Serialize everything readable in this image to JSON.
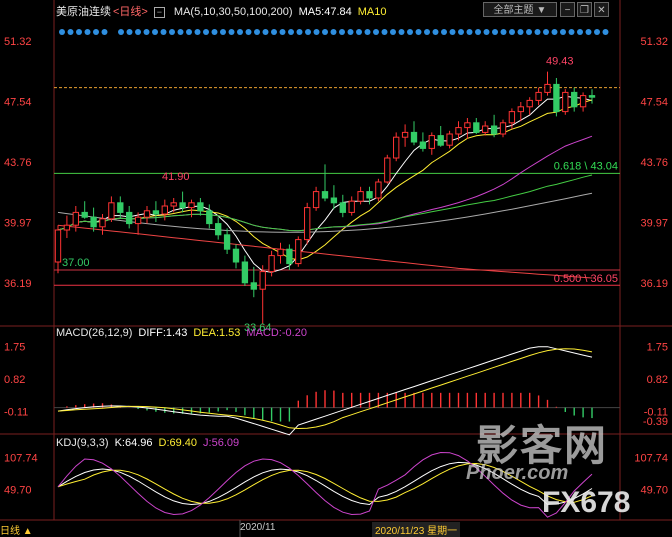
{
  "header": {
    "instrument": "美原油连续",
    "period": "<日线>",
    "ma_label": "MA(5,10,30,50,100,200)",
    "ma5_label": "MA5:47.84",
    "ma10_label": "MA10",
    "theme_button": "全部主题",
    "theme_arrow": "▼"
  },
  "macd_header": {
    "title": "MACD(26,12,9)",
    "diff": "DIFF:1.43",
    "dea": "DEA:1.53",
    "macd": "MACD:-0.20"
  },
  "kdj_header": {
    "title": "KDJ(9,3,3)",
    "k": "K:64.96",
    "d": "D:69.40",
    "j": "J:56.09"
  },
  "price_axis_ticks": [
    "51.32",
    "47.54",
    "43.76",
    "39.97",
    "36.19"
  ],
  "macd_axis_ticks": [
    "1.75",
    "0.82",
    "-0.11"
  ],
  "macd_axis_extra": "-0.39",
  "kdj_axis_ticks": [
    "107.74",
    "49.70"
  ],
  "annotations": {
    "high": "49.43",
    "low": "33.64",
    "peak_left": "41.90",
    "level_37": "37.00",
    "fib_618": "0.618 \\ 43.04",
    "fib_500": "0.500 \\ 36.05"
  },
  "footer": {
    "period_tab": "日线 ▲",
    "month_label": "2020/11",
    "cursor_date": "2020/11/23 星期一"
  },
  "watermark": {
    "cn": "影客网",
    "en": "Phoer.com",
    "brand": "FX678"
  },
  "colors": {
    "up": "#ff3333",
    "down": "#33cc66",
    "ma5": "#ffffff",
    "ma10": "#ffee33",
    "ma30": "#cc44cc",
    "ma50": "#44cc44",
    "ma100": "#aaaaaa",
    "ma200": "#ee4444"
  },
  "chart_data": {
    "type": "candlestick",
    "price_range": [
      33.0,
      52.0
    ],
    "candles": [
      [
        37.5,
        39.8,
        36.8,
        39.5
      ],
      [
        39.5,
        40.4,
        39.0,
        39.8
      ],
      [
        39.8,
        41.0,
        39.4,
        40.6
      ],
      [
        40.6,
        41.3,
        40.2,
        40.3
      ],
      [
        40.3,
        40.9,
        39.4,
        39.7
      ],
      [
        39.7,
        40.5,
        39.2,
        40.2
      ],
      [
        40.2,
        41.6,
        40.0,
        41.2
      ],
      [
        41.2,
        41.6,
        40.2,
        40.6
      ],
      [
        40.6,
        41.0,
        39.6,
        39.9
      ],
      [
        39.9,
        40.6,
        39.2,
        40.3
      ],
      [
        40.3,
        41.0,
        39.9,
        40.7
      ],
      [
        40.7,
        41.3,
        40.0,
        40.5
      ],
      [
        40.5,
        41.4,
        40.1,
        41.0
      ],
      [
        41.0,
        41.5,
        40.6,
        41.2
      ],
      [
        41.2,
        41.9,
        40.6,
        40.9
      ],
      [
        40.9,
        41.4,
        40.3,
        41.2
      ],
      [
        41.2,
        41.5,
        40.4,
        40.7
      ],
      [
        40.7,
        41.1,
        39.6,
        39.9
      ],
      [
        39.9,
        40.3,
        38.9,
        39.2
      ],
      [
        39.2,
        39.6,
        38.0,
        38.3
      ],
      [
        38.3,
        38.6,
        37.1,
        37.5
      ],
      [
        37.5,
        37.9,
        36.0,
        36.2
      ],
      [
        36.2,
        37.2,
        35.3,
        35.8
      ],
      [
        35.8,
        37.3,
        33.6,
        36.9
      ],
      [
        36.9,
        38.2,
        36.6,
        37.9
      ],
      [
        37.9,
        38.7,
        37.4,
        38.3
      ],
      [
        38.3,
        38.6,
        37.0,
        37.4
      ],
      [
        37.4,
        39.1,
        37.2,
        38.9
      ],
      [
        38.9,
        41.2,
        38.6,
        40.9
      ],
      [
        40.9,
        42.2,
        40.7,
        41.9
      ],
      [
        41.9,
        43.6,
        41.3,
        41.5
      ],
      [
        41.5,
        42.3,
        40.8,
        41.2
      ],
      [
        41.2,
        41.7,
        40.3,
        40.6
      ],
      [
        40.6,
        41.6,
        40.4,
        41.3
      ],
      [
        41.3,
        42.2,
        41.1,
        41.9
      ],
      [
        41.9,
        42.2,
        41.1,
        41.5
      ],
      [
        41.5,
        42.7,
        41.3,
        42.5
      ],
      [
        42.5,
        44.2,
        42.4,
        44.0
      ],
      [
        44.0,
        45.6,
        43.8,
        45.3
      ],
      [
        45.3,
        46.1,
        44.7,
        45.6
      ],
      [
        45.6,
        46.3,
        44.8,
        45.0
      ],
      [
        45.0,
        45.6,
        44.4,
        44.6
      ],
      [
        44.6,
        45.6,
        44.2,
        45.4
      ],
      [
        45.4,
        46.0,
        44.7,
        44.8
      ],
      [
        44.8,
        45.7,
        44.6,
        45.5
      ],
      [
        45.5,
        46.3,
        45.1,
        45.9
      ],
      [
        45.9,
        46.5,
        45.2,
        46.2
      ],
      [
        46.2,
        46.5,
        45.5,
        45.6
      ],
      [
        45.6,
        46.3,
        45.4,
        46.0
      ],
      [
        46.0,
        46.7,
        45.3,
        45.5
      ],
      [
        45.5,
        46.4,
        45.3,
        46.2
      ],
      [
        46.2,
        47.1,
        45.8,
        46.9
      ],
      [
        46.9,
        47.5,
        46.3,
        47.2
      ],
      [
        47.2,
        47.8,
        46.7,
        47.6
      ],
      [
        47.6,
        48.4,
        47.3,
        48.1
      ],
      [
        48.1,
        49.4,
        47.9,
        48.6
      ],
      [
        48.6,
        49.0,
        46.6,
        46.9
      ],
      [
        46.9,
        48.3,
        46.7,
        48.1
      ],
      [
        48.1,
        48.4,
        46.9,
        47.2
      ],
      [
        47.2,
        48.1,
        46.9,
        47.9
      ],
      [
        47.9,
        48.3,
        47.4,
        47.8
      ]
    ],
    "horizontal_levels": [
      {
        "value": 48.4,
        "style": "dashed",
        "color": "#e8a030"
      },
      {
        "value": 43.04,
        "style": "solid",
        "color": "#44cc44"
      },
      {
        "value": 36.05,
        "style": "solid",
        "color": "#ee3344"
      }
    ],
    "macd_range": [
      -0.7,
      2.0
    ],
    "kdj_range": [
      -5,
      125
    ]
  }
}
